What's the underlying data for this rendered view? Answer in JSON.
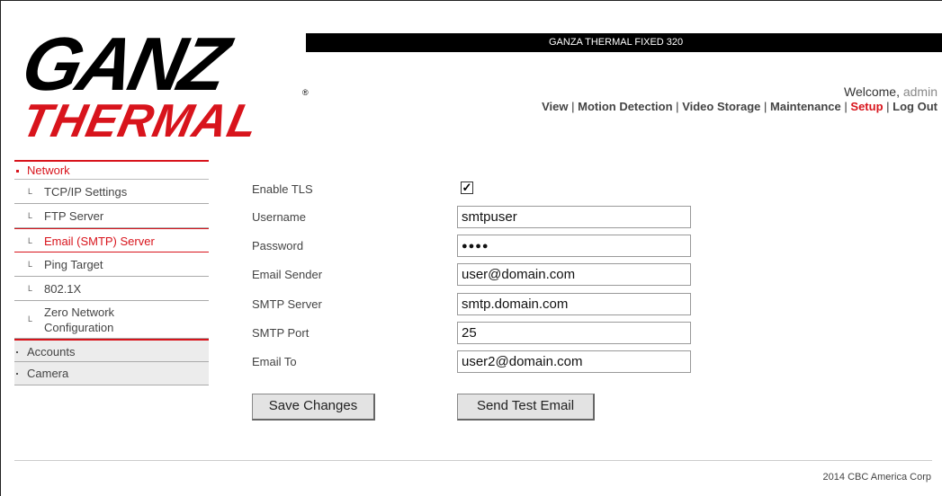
{
  "header": {
    "device_title": "GANZA THERMAL FIXED 320",
    "logo_text_top": "GANZ",
    "logo_text_bottom": "THERMAL",
    "welcome_label": "Welcome,",
    "welcome_user": "admin"
  },
  "topnav": {
    "items": [
      "View",
      "Motion Detection",
      "Video Storage",
      "Maintenance",
      "Setup",
      "Log Out"
    ],
    "active": "Setup",
    "separator": "|"
  },
  "sidebar": {
    "section": "Network",
    "items": [
      {
        "label": "TCP/IP Settings"
      },
      {
        "label": "FTP Server"
      },
      {
        "label": "Email (SMTP) Server"
      },
      {
        "label": "Ping Target"
      },
      {
        "label": "802.1X"
      },
      {
        "label": "Zero Network Configuration"
      }
    ],
    "item_marker": "L",
    "groups": [
      "Accounts",
      "Camera"
    ]
  },
  "form": {
    "enable_tls": {
      "label": "Enable TLS",
      "checked": true,
      "mark": "✓"
    },
    "username": {
      "label": "Username",
      "value": "smtpuser"
    },
    "password": {
      "label": "Password",
      "value": "●●●●"
    },
    "email_sender": {
      "label": "Email Sender",
      "value": "user@domain.com"
    },
    "smtp_server": {
      "label": "SMTP Server",
      "value": "smtp.domain.com"
    },
    "smtp_port": {
      "label": "SMTP Port",
      "value": "25"
    },
    "email_to": {
      "label": "Email To",
      "value": "user2@domain.com"
    }
  },
  "buttons": {
    "save": "Save Changes",
    "test": "Send Test Email"
  },
  "footer": {
    "copyright": "2014 CBC America Corp"
  },
  "colors": {
    "brand_red": "#d8141c",
    "header_black": "#000000"
  }
}
